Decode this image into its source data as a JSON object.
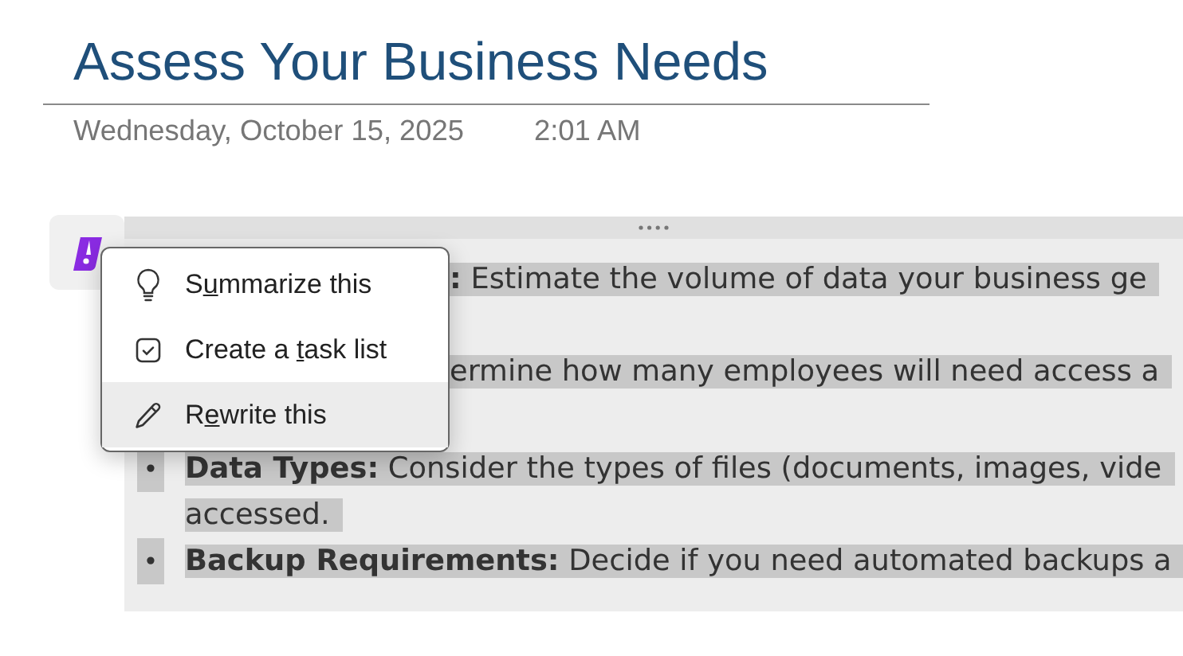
{
  "page": {
    "title": "Assess Your Business Needs",
    "date": "Wednesday, October 15, 2025",
    "time": "2:01 AM"
  },
  "outline": {
    "items": [
      {
        "lines": [
          "**:** Estimate the volume of data your business ge"
        ]
      },
      {
        "lines": [
          "ermine how many employees will need access a"
        ]
      },
      {
        "bullet": "•",
        "lines": [
          "**Data Types:** Consider the types of files (documents, images, vide",
          "accessed."
        ]
      },
      {
        "bullet": "•",
        "lines": [
          "**Backup Requirements:** Decide if you need automated backups a"
        ]
      }
    ]
  },
  "context_menu": {
    "items": [
      {
        "label_parts": [
          "S",
          "u",
          "mmarize this"
        ],
        "selected": false
      },
      {
        "label_parts": [
          "Create a ",
          "t",
          "ask list"
        ],
        "selected": false
      },
      {
        "label_parts": [
          "R",
          "e",
          "write this"
        ],
        "selected": true
      }
    ]
  }
}
